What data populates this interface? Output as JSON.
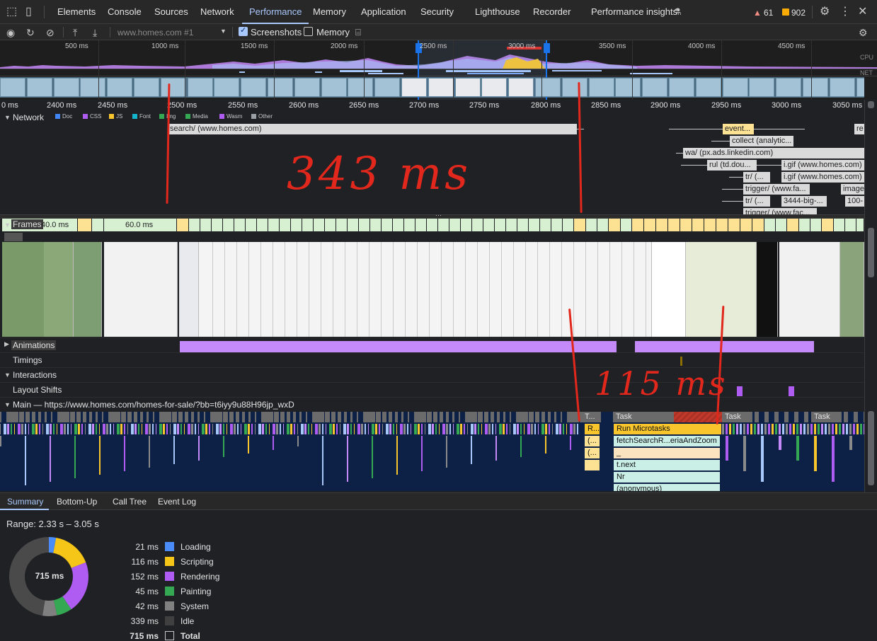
{
  "tabs": {
    "elements": "Elements",
    "console": "Console",
    "sources": "Sources",
    "network": "Network",
    "performance": "Performance",
    "memory": "Memory",
    "application": "Application",
    "security": "Security",
    "lighthouse": "Lighthouse",
    "recorder": "Recorder",
    "insights": "Performance insights",
    "warnings": "61",
    "errors": "902"
  },
  "toolbar": {
    "target": "www.homes.com #1",
    "screenshots_label": "Screenshots",
    "screenshots_checked": true,
    "memory_label": "Memory",
    "memory_checked": false
  },
  "overview": {
    "ticks": [
      "500 ms",
      "1000 ms",
      "1500 ms",
      "2000 ms",
      "2500 ms",
      "3000 ms",
      "3500 ms",
      "4000 ms",
      "4500 ms"
    ],
    "cpu_label": "CPU",
    "net_label": "NET"
  },
  "ruler": {
    "ticks": [
      "0 ms",
      "2400 ms",
      "2450 ms",
      "2500 ms",
      "2550 ms",
      "2600 ms",
      "2650 ms",
      "2700 ms",
      "2750 ms",
      "2800 ms",
      "2850 ms",
      "2900 ms",
      "2950 ms",
      "3000 ms",
      "3050 ms"
    ]
  },
  "network": {
    "label": "Network",
    "legend": [
      {
        "name": "Doc",
        "color": "#4285f4"
      },
      {
        "name": "CSS",
        "color": "#af5cf2"
      },
      {
        "name": "JS",
        "color": "#f9c52c"
      },
      {
        "name": "Font",
        "color": "#12b5cb"
      },
      {
        "name": "Img",
        "color": "#34a853"
      },
      {
        "name": "Media",
        "color": "#34a853"
      },
      {
        "name": "Wasm",
        "color": "#af5cf2"
      },
      {
        "name": "Other",
        "color": "#9aa0a6"
      }
    ],
    "requests": {
      "search": "search/ (www.homes.com)",
      "event": "event...",
      "re": "re",
      "collect": "collect (analytic...",
      "wa": "wa/ (px.ads.linkedin.com)",
      "rul": "rul (td.dou...",
      "igif1": "i.gif (www.homes.com)",
      "tr1": "tr/ (...",
      "igif2": "i.gif (www.homes.com)",
      "trigger": "trigger/ (www.fa...",
      "image": "image",
      "tr2": "tr/ (...",
      "big": "3444-big-...",
      "n100": "100-",
      "trigger2": "trigger/ (www.fac..."
    }
  },
  "frames": {
    "label": "Frames",
    "t40": "40.0 ms",
    "t60": "60.0 ms"
  },
  "tracks": {
    "animations": "Animations",
    "timings": "Timings",
    "interactions": "Interactions",
    "layout_shifts": "Layout Shifts",
    "main": "Main — https://www.homes.com/homes-for-sale/?bb=t6iyy9u88H96jp_wxD"
  },
  "flame": {
    "task1": "T...",
    "task2": "Task",
    "task3": "Task",
    "task4": "Task",
    "run_microtasks": "Run Microtasks",
    "r": "R...",
    "fetch": "fetchSearchR...eriaAndZoom",
    "paren": "(...",
    "paren2": "(...",
    "underscore": "_",
    "tnext": "t.next",
    "nr": "Nr",
    "anon": "(anonymous)"
  },
  "annotations": {
    "a343": "343 ms",
    "a115": "115 ms"
  },
  "bottom_tabs": [
    "Summary",
    "Bottom-Up",
    "Call Tree",
    "Event Log"
  ],
  "summary": {
    "range": "Range: 2.33 s – 3.05 s",
    "total_center": "715 ms",
    "rows": [
      {
        "value": "21 ms",
        "label": "Loading",
        "color": "#4b8df8"
      },
      {
        "value": "116 ms",
        "label": "Scripting",
        "color": "#f5c518"
      },
      {
        "value": "152 ms",
        "label": "Rendering",
        "color": "#af5cf2"
      },
      {
        "value": "45 ms",
        "label": "Painting",
        "color": "#34a853"
      },
      {
        "value": "42 ms",
        "label": "System",
        "color": "#808080"
      },
      {
        "value": "339 ms",
        "label": "Idle",
        "color": "#404040"
      },
      {
        "value": "715 ms",
        "label": "Total",
        "color": "transparent"
      }
    ]
  }
}
